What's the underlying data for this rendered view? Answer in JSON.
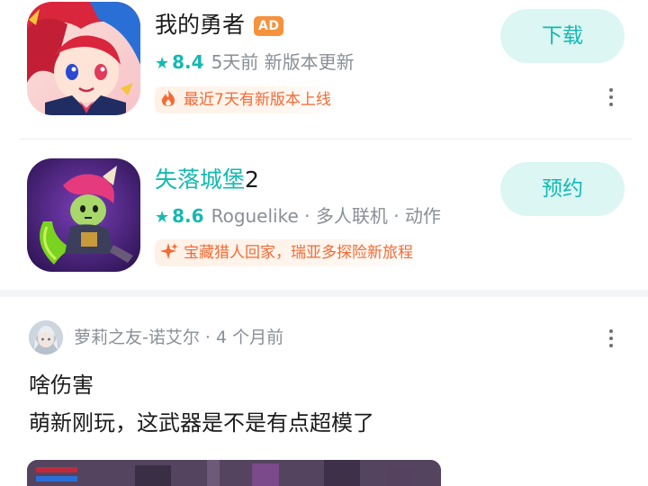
{
  "apps": [
    {
      "title": "我的勇者",
      "title_highlight": "",
      "title_suffix": "",
      "badge": "AD",
      "rating": "8.4",
      "meta": "5天前 新版本更新",
      "tagline": "最近7天有新版本上线",
      "tagline_icon": "flame-icon",
      "action_label": "下载"
    },
    {
      "title": "",
      "title_highlight": "失落城堡",
      "title_suffix": "2",
      "badge": "",
      "rating": "8.6",
      "meta": "Roguelike · 多人联机 · 动作",
      "tagline": "宝藏猎人回家，瑞亚多探险新旅程",
      "tagline_icon": "sparkle-icon",
      "action_label": "预约"
    }
  ],
  "post": {
    "author": "萝莉之友-诺艾尔",
    "time": "4 个月前",
    "title": "啥伤害",
    "body": "萌新刚玩，这武器是不是有点超模了"
  },
  "colors": {
    "accent": "#14b9b2",
    "button_bg": "#dcf6f4",
    "ad_badge": "#f6923c",
    "tagline_text": "#f36a36"
  }
}
